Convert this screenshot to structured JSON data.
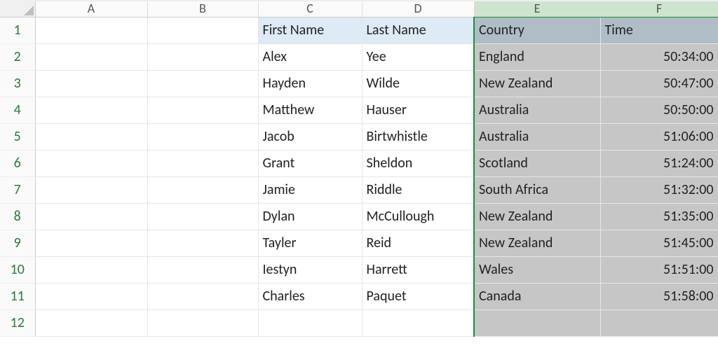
{
  "columns": [
    "A",
    "B",
    "C",
    "D",
    "E",
    "F"
  ],
  "selected_columns": [
    "E",
    "F"
  ],
  "visible_row_count": 12,
  "header_row": {
    "first_name": "First Name",
    "last_name": "Last Name",
    "country": "Country",
    "time": "Time"
  },
  "rows": [
    {
      "first_name": "Alex",
      "last_name": "Yee",
      "country": "England",
      "time": "50:34:00"
    },
    {
      "first_name": "Hayden",
      "last_name": "Wilde",
      "country": "New Zealand",
      "time": "50:47:00"
    },
    {
      "first_name": "Matthew",
      "last_name": "Hauser",
      "country": "Australia",
      "time": "50:50:00"
    },
    {
      "first_name": "Jacob",
      "last_name": "Birtwhistle",
      "country": "Australia",
      "time": "51:06:00"
    },
    {
      "first_name": "Grant",
      "last_name": "Sheldon",
      "country": "Scotland",
      "time": "51:24:00"
    },
    {
      "first_name": "Jamie",
      "last_name": "Riddle",
      "country": "South Africa",
      "time": "51:32:00"
    },
    {
      "first_name": "Dylan",
      "last_name": "McCullough",
      "country": "New Zealand",
      "time": "51:35:00"
    },
    {
      "first_name": "Tayler",
      "last_name": "Reid",
      "country": "New Zealand",
      "time": "51:45:00"
    },
    {
      "first_name": "Iestyn",
      "last_name": "Harrett",
      "country": "Wales",
      "time": "51:51:00"
    },
    {
      "first_name": "Charles",
      "last_name": "Paquet",
      "country": "Canada",
      "time": "51:58:00"
    }
  ],
  "chart_data": {
    "type": "table",
    "columns": [
      "First Name",
      "Last Name",
      "Country",
      "Time"
    ],
    "rows": [
      [
        "Alex",
        "Yee",
        "England",
        "50:34:00"
      ],
      [
        "Hayden",
        "Wilde",
        "New Zealand",
        "50:47:00"
      ],
      [
        "Matthew",
        "Hauser",
        "Australia",
        "50:50:00"
      ],
      [
        "Jacob",
        "Birtwhistle",
        "Australia",
        "51:06:00"
      ],
      [
        "Grant",
        "Sheldon",
        "Scotland",
        "51:24:00"
      ],
      [
        "Jamie",
        "Riddle",
        "South Africa",
        "51:32:00"
      ],
      [
        "Dylan",
        "McCullough",
        "New Zealand",
        "51:35:00"
      ],
      [
        "Tayler",
        "Reid",
        "New Zealand",
        "51:45:00"
      ],
      [
        "Iestyn",
        "Harrett",
        "Wales",
        "51:51:00"
      ],
      [
        "Charles",
        "Paquet",
        "Canada",
        "51:58:00"
      ]
    ]
  }
}
